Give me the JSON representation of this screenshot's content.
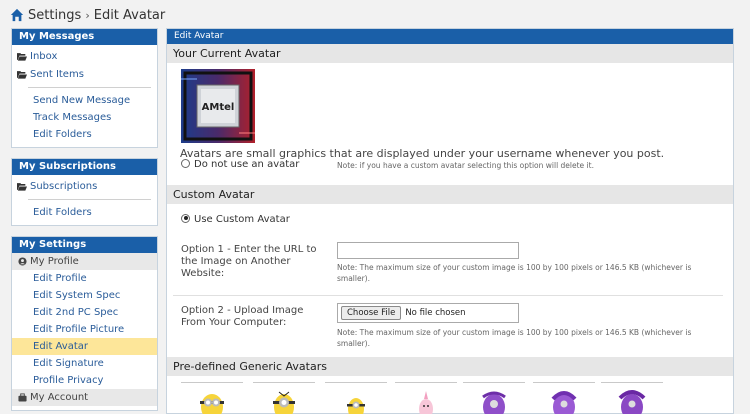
{
  "breadcrumb": {
    "home": "Settings",
    "current": "Edit Avatar"
  },
  "sidebar": {
    "messages": {
      "title": "My Messages",
      "folders": [
        "Inbox",
        "Sent Items"
      ],
      "links": [
        "Send New Message",
        "Track Messages",
        "Edit Folders"
      ]
    },
    "subscriptions": {
      "title": "My Subscriptions",
      "folders": [
        "Subscriptions"
      ],
      "links": [
        "Edit Folders"
      ]
    },
    "settings": {
      "title": "My Settings",
      "profile_head": "My Profile",
      "links": [
        "Edit Profile",
        "Edit System Spec",
        "Edit 2nd PC Spec",
        "Edit Profile Picture",
        "Edit Avatar",
        "Edit Signature",
        "Profile Privacy"
      ],
      "active": "Edit Avatar",
      "account_head": "My Account"
    }
  },
  "main": {
    "title": "Edit Avatar",
    "current_section": "Your Current Avatar",
    "avatar_caption": "Avatars are small graphics that are displayed under your username whenever you post.",
    "avatar_logo_text": "AMtel",
    "no_avatar_label": "Do not use an avatar",
    "no_avatar_note": "Note: if you have a custom avatar selecting this option will delete it.",
    "custom_section": "Custom Avatar",
    "use_custom_label": "Use Custom Avatar",
    "option1_label": "Option 1 - Enter the URL to the Image on Another Website:",
    "url_value": "",
    "option1_hint": "Note: The maximum size of your custom image is 100 by 100 pixels or 146.5 KB (whichever is smaller).",
    "option2_label": "Option 2 - Upload Image From Your Computer:",
    "choose_file_label": "Choose File",
    "no_file_label": "No file chosen",
    "option2_hint": "Note: The maximum size of your custom image is 100 by 100 pixels or 146.5 KB (whichever is smaller).",
    "predefined_section": "Pre-defined Generic Avatars"
  },
  "colors": {
    "header_blue": "#1a5fa8",
    "link_blue": "#2a5c99",
    "active_highlight": "#fde699"
  }
}
